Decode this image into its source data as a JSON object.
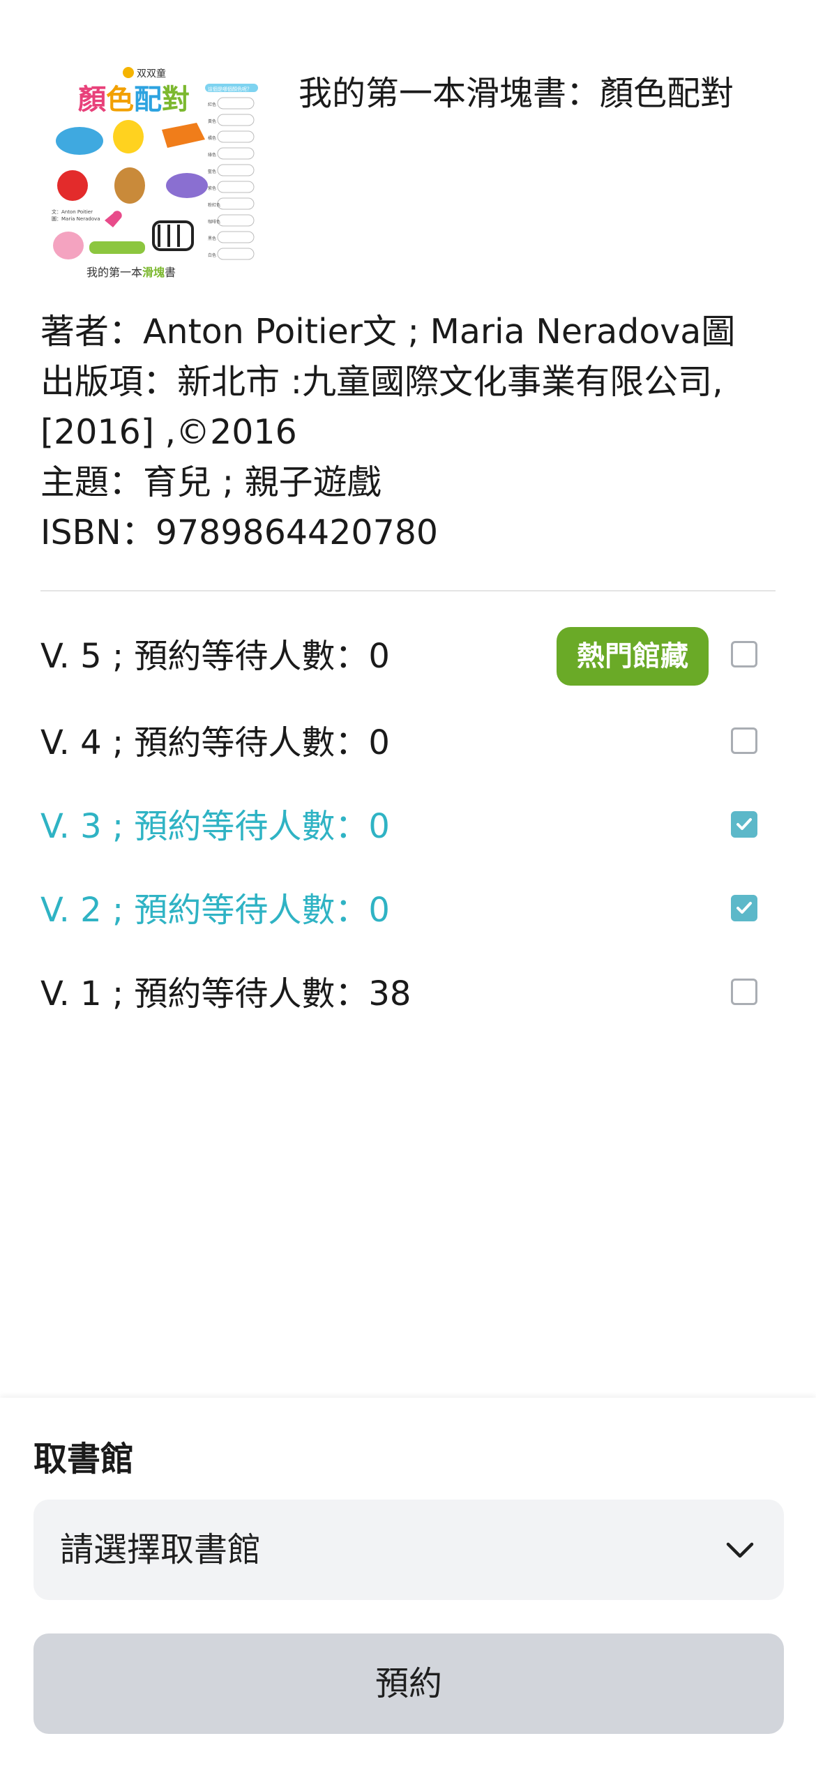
{
  "book": {
    "title": "我的第一本滑塊書：顏色配對",
    "author_line": "著者：Anton Poitier文 ; Maria Neradova圖",
    "publisher_line1": "出版項：新北市 :九童國際文化事業有限公司,",
    "publisher_line2": "[2016] ,©2016",
    "subject_line": "主題：育兒 ; 親子遊戲",
    "isbn_line": "ISBN：9789864420780"
  },
  "cover": {
    "brand": "双双童",
    "title_chars": [
      "顏",
      "色",
      "配",
      "對"
    ],
    "side_header": "這個是哪個顏色呢？",
    "side_labels": [
      "紅色",
      "黃色",
      "橘色",
      "綠色",
      "藍色",
      "紫色",
      "粉紅色",
      "咖啡色",
      "黑色",
      "白色"
    ],
    "credit1": "文：Anton Poitier",
    "credit2": "圖：Maria Neradova",
    "bottom_pre": "我的第一本",
    "bottom_highlight": "滑塊",
    "bottom_post": "書"
  },
  "volumes": [
    {
      "label": "V. 5 ; 預約等待人數：0",
      "badge": "熱門館藏",
      "checked": false
    },
    {
      "label": "V. 4 ; 預約等待人數：0",
      "checked": false
    },
    {
      "label": "V. 3 ; 預約等待人數：0",
      "checked": true
    },
    {
      "label": "V. 2 ; 預約等待人數：0",
      "checked": true
    },
    {
      "label": "V. 1 ; 預約等待人數：38",
      "checked": false
    }
  ],
  "pickup": {
    "title": "取書館",
    "placeholder": "請選擇取書館",
    "reserve_label": "預約"
  },
  "colors": {
    "accent": "#2fb3c4",
    "badge": "#6aaa27",
    "checkbox_checked": "#5cb8c9",
    "button_disabled": "#d2d5db"
  }
}
